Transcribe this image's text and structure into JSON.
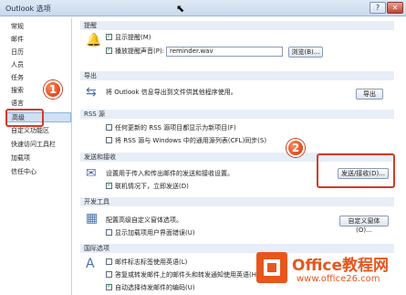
{
  "window": {
    "title": "Outlook 选项",
    "help_label": "?",
    "close_label": "✕"
  },
  "sidebar": {
    "items": [
      {
        "label": "常规"
      },
      {
        "label": "邮件"
      },
      {
        "label": "日历"
      },
      {
        "label": "人员"
      },
      {
        "label": "任务"
      },
      {
        "label": "搜索"
      },
      {
        "label": "语言"
      },
      {
        "label": "高级"
      },
      {
        "label": "自定义功能区"
      },
      {
        "label": "快速访问工具栏"
      },
      {
        "label": "加载项"
      },
      {
        "label": "信任中心"
      }
    ],
    "selected_index": 7
  },
  "sections": {
    "reminders": {
      "header": "提醒",
      "show_reminders": "显示提醒(M)",
      "play_sound": "播放提醒声音(P):",
      "sound_file": "reminder.wav",
      "browse_label": "浏览(B)..."
    },
    "export": {
      "header": "导出",
      "description": "将 Outlook 信息导出到文件供其他程序使用。",
      "export_label": "导出"
    },
    "rss": {
      "header": "RSS 源",
      "opt_updated": "任何更新的 RSS 源项目都显示为新项目(F)",
      "opt_sync": "将 RSS 源与 Windows 中的通用源列表(CFL)同步(S)"
    },
    "send_receive": {
      "header": "发送和接收",
      "description": "设置用于传入和传出邮件的发送和接收设置。",
      "send_immediately": "联机情况下，立即发送(D)",
      "button_label": "发送/接收(D)..."
    },
    "developers": {
      "header": "开发工具",
      "description": "配置高级自定义窗体选项。",
      "show_errors": "显示加载项用户界面错误(U)",
      "button_label": "自定义窗体(O)..."
    },
    "international": {
      "header": "国际选项",
      "opt_english_flags": "邮件标志标签使用英语(L)",
      "opt_english_headers": "答复或转发邮件上的邮件头和转发通知使用英语(H)",
      "opt_auto_encoding": "自动选择待发邮件的编码(U)"
    }
  },
  "callouts": {
    "step1": "1",
    "step2": "2"
  },
  "watermark": {
    "brand": "Office教程网",
    "url": "www.office26.com"
  },
  "colors": {
    "callout_red": "#d43a2a",
    "selected_bg": "#cfe0f5",
    "brand_orange": "#e8561e"
  }
}
